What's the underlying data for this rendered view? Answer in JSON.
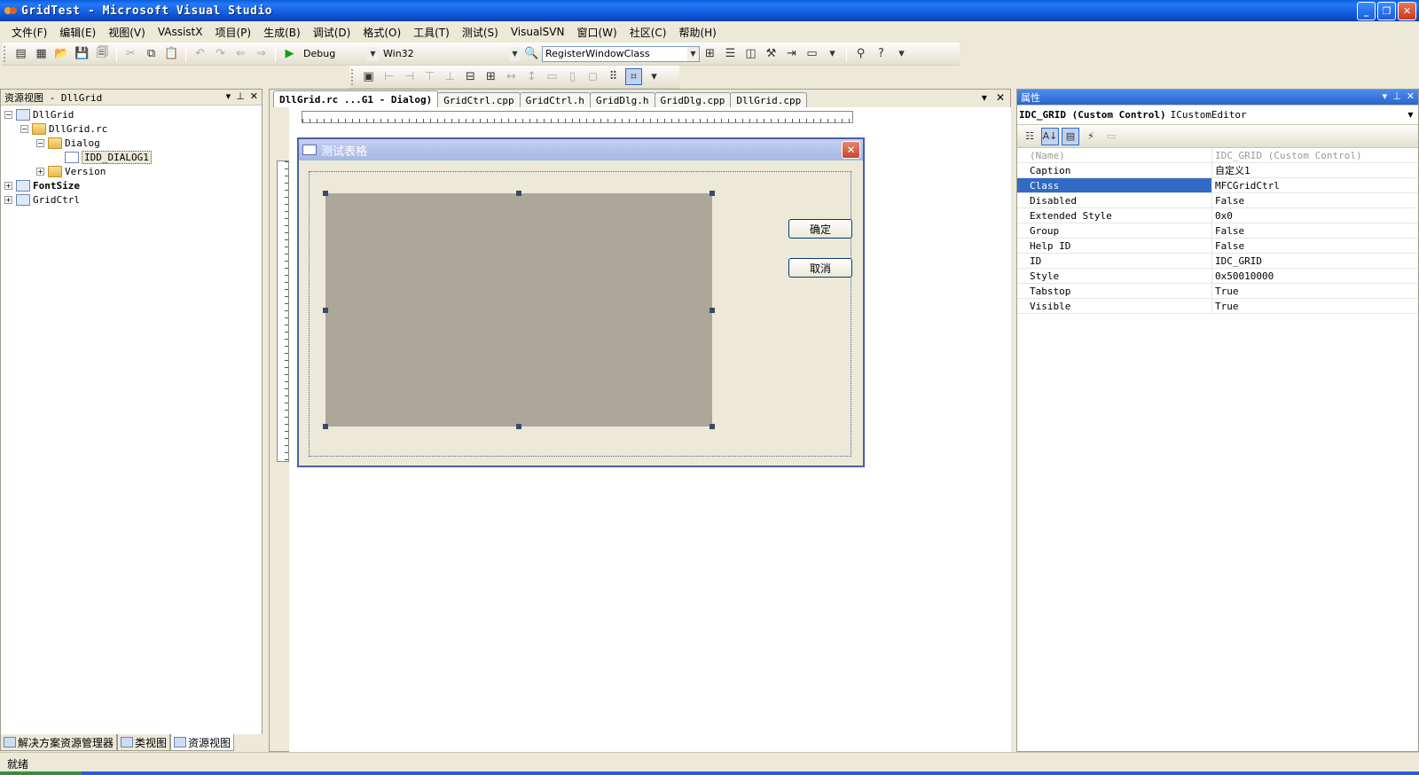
{
  "window": {
    "title": "GridTest - Microsoft Visual Studio",
    "min_icon": "minimize-icon",
    "max_icon": "restore-icon",
    "close_icon": "close-icon"
  },
  "menu": [
    "文件(F)",
    "编辑(E)",
    "视图(V)",
    "VAssistX",
    "项目(P)",
    "生成(B)",
    "调试(D)",
    "格式(O)",
    "工具(T)",
    "测试(S)",
    "VisualSVN",
    "窗口(W)",
    "社区(C)",
    "帮助(H)"
  ],
  "toolbar": {
    "config": "Debug",
    "platform": "Win32",
    "find_combo": "RegisterWindowClass"
  },
  "resource_view": {
    "title": "资源视图 - DllGrid",
    "tree": [
      {
        "label": "DllGrid",
        "level": 0,
        "exp": "-",
        "icon": "project"
      },
      {
        "label": "DllGrid.rc",
        "level": 1,
        "exp": "-",
        "icon": "folder"
      },
      {
        "label": "Dialog",
        "level": 2,
        "exp": "-",
        "icon": "folder"
      },
      {
        "label": "IDD_DIALOG1",
        "level": 3,
        "exp": "",
        "icon": "dialog",
        "selected": true
      },
      {
        "label": "Version",
        "level": 2,
        "exp": "+",
        "icon": "folder"
      },
      {
        "label": "FontSize",
        "level": 0,
        "exp": "+",
        "icon": "project",
        "bold": true
      },
      {
        "label": "GridCtrl",
        "level": 0,
        "exp": "+",
        "icon": "project"
      }
    ],
    "bottom_tabs": [
      "解决方案资源管理器",
      "类视图",
      "资源视图"
    ]
  },
  "editor": {
    "tabs": [
      "DllGrid.rc ...G1 - Dialog)",
      "GridCtrl.cpp",
      "GridCtrl.h",
      "GridDlg.h",
      "GridDlg.cpp",
      "DllGrid.cpp"
    ],
    "active_tab": 0,
    "dialog": {
      "title": "测试表格",
      "ok_button": "确定",
      "cancel_button": "取消"
    }
  },
  "properties": {
    "title": "属性",
    "object": "IDC_GRID (Custom Control)",
    "object_type": "ICustomEditor",
    "rows": [
      {
        "name": "(Name)",
        "value": "IDC_GRID (Custom Control)",
        "grey": true
      },
      {
        "name": "Caption",
        "value": "自定义1"
      },
      {
        "name": "Class",
        "value": "MFCGridCtrl",
        "selected": true
      },
      {
        "name": "Disabled",
        "value": "False"
      },
      {
        "name": "Extended Style",
        "value": "0x0"
      },
      {
        "name": "Group",
        "value": "False"
      },
      {
        "name": "Help ID",
        "value": "False"
      },
      {
        "name": "ID",
        "value": "IDC_GRID"
      },
      {
        "name": "Style",
        "value": "0x50010000"
      },
      {
        "name": "Tabstop",
        "value": "True"
      },
      {
        "name": "Visible",
        "value": "True"
      }
    ]
  },
  "status": "就绪"
}
